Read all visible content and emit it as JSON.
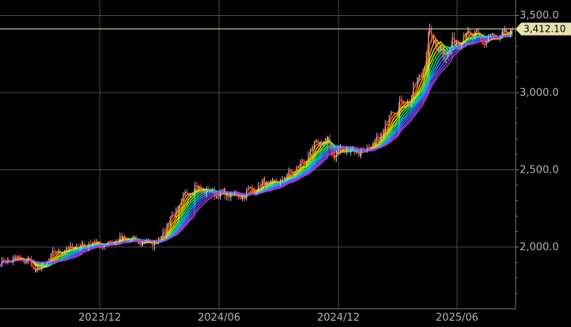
{
  "chart_data": {
    "type": "line",
    "description_free": true,
    "x_labels": [
      "2023/12",
      "2024/06",
      "2024/12",
      "2025/06"
    ],
    "y_ticks": [
      "2,000.0",
      "2,500.0",
      "3,000.0",
      "3,500.0"
    ],
    "y_tick_values": [
      2000,
      2500,
      3000,
      3500
    ],
    "ylim": [
      1600,
      3600
    ],
    "grid": true,
    "last_price": 3412.1,
    "last_price_label": "3,412.10",
    "x_domain": [
      "2023-07-01",
      "2025-08-25"
    ],
    "x_label_dates": [
      "2023-12-01",
      "2024-06-01",
      "2024-12-01",
      "2025-06-01"
    ],
    "series": [
      {
        "values": [
          [
            "2023-07-01",
            1895
          ],
          [
            "2023-07-15",
            1915
          ],
          [
            "2023-08-01",
            1920
          ],
          [
            "2023-08-15",
            1905
          ],
          [
            "2023-08-25",
            1845
          ],
          [
            "2023-09-05",
            1875
          ],
          [
            "2023-09-20",
            1950
          ],
          [
            "2023-10-05",
            1985
          ],
          [
            "2023-10-20",
            1990
          ],
          [
            "2023-11-05",
            2010
          ],
          [
            "2023-11-20",
            2030
          ],
          [
            "2023-12-05",
            2010
          ],
          [
            "2023-12-20",
            2040
          ],
          [
            "2024-01-05",
            2050
          ],
          [
            "2024-01-20",
            2040
          ],
          [
            "2024-02-05",
            2030
          ],
          [
            "2024-02-20",
            2025
          ],
          [
            "2024-03-01",
            2050
          ],
          [
            "2024-03-15",
            2160
          ],
          [
            "2024-04-01",
            2260
          ],
          [
            "2024-04-15",
            2370
          ],
          [
            "2024-04-25",
            2390
          ],
          [
            "2024-05-10",
            2360
          ],
          [
            "2024-05-25",
            2350
          ],
          [
            "2024-06-10",
            2340
          ],
          [
            "2024-06-25",
            2330
          ],
          [
            "2024-07-10",
            2340
          ],
          [
            "2024-07-25",
            2380
          ],
          [
            "2024-08-10",
            2410
          ],
          [
            "2024-08-25",
            2400
          ],
          [
            "2024-09-10",
            2450
          ],
          [
            "2024-09-25",
            2500
          ],
          [
            "2024-10-10",
            2560
          ],
          [
            "2024-10-25",
            2640
          ],
          [
            "2024-11-05",
            2700
          ],
          [
            "2024-11-15",
            2670
          ],
          [
            "2024-11-25",
            2590
          ],
          [
            "2024-12-05",
            2640
          ],
          [
            "2024-12-20",
            2630
          ],
          [
            "2025-01-05",
            2620
          ],
          [
            "2025-01-20",
            2640
          ],
          [
            "2025-02-05",
            2720
          ],
          [
            "2025-02-20",
            2890
          ],
          [
            "2025-03-05",
            2930
          ],
          [
            "2025-03-20",
            2960
          ],
          [
            "2025-04-01",
            3060
          ],
          [
            "2025-04-12",
            3200
          ],
          [
            "2025-04-20",
            3380
          ],
          [
            "2025-05-01",
            3300
          ],
          [
            "2025-05-12",
            3240
          ],
          [
            "2025-05-25",
            3320
          ],
          [
            "2025-06-05",
            3350
          ],
          [
            "2025-06-15",
            3390
          ],
          [
            "2025-06-25",
            3360
          ],
          [
            "2025-07-10",
            3330
          ],
          [
            "2025-07-25",
            3360
          ],
          [
            "2025-08-10",
            3350
          ],
          [
            "2025-08-25",
            3412.1
          ]
        ]
      }
    ]
  }
}
